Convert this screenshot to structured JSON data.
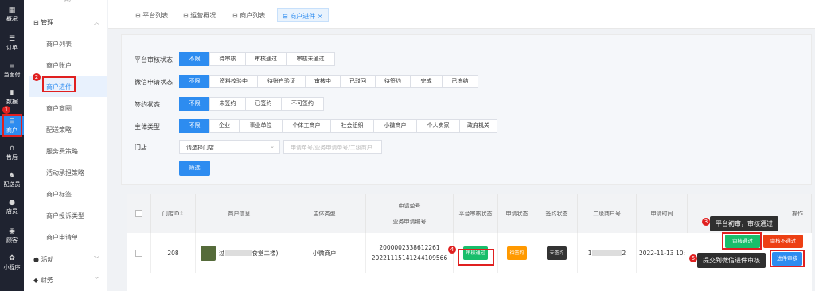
{
  "left_nav": [
    {
      "icon": "chart-icon",
      "label": "概况"
    },
    {
      "icon": "list-icon",
      "label": "订单"
    },
    {
      "icon": "pay-icon",
      "label": "当面付"
    },
    {
      "icon": "data-icon",
      "label": "数据"
    },
    {
      "icon": "store-icon",
      "label": "商户"
    },
    {
      "icon": "headset-icon",
      "label": "售后"
    },
    {
      "icon": "rider-icon",
      "label": "配送员"
    },
    {
      "icon": "user-icon",
      "label": "店员"
    },
    {
      "icon": "customer-icon",
      "label": "顾客"
    },
    {
      "icon": "miniapp-icon",
      "label": "小程序"
    }
  ],
  "submenu": {
    "top_partial": "商户",
    "group": "管理",
    "items": [
      "商户列表",
      "商户账户",
      "商户进件",
      "商户商圈",
      "配送策略",
      "服务费策略",
      "活动承担策略",
      "商户标签",
      "商户投诉类型",
      "商户申请单"
    ],
    "more": [
      "活动",
      "财务"
    ]
  },
  "tabs": [
    "平台列表",
    "运营概况",
    "商户列表",
    "商户进件"
  ],
  "filters": {
    "rows": [
      {
        "label": "平台审核状态",
        "options": [
          "不限",
          "待审核",
          "审核通过",
          "审核未通过"
        ]
      },
      {
        "label": "微信申请状态",
        "options": [
          "不限",
          "资料校验中",
          "待账户验证",
          "审核中",
          "已驳回",
          "待签约",
          "完成",
          "已冻结"
        ]
      },
      {
        "label": "签约状态",
        "options": [
          "不限",
          "未签约",
          "已签约",
          "不可签约"
        ]
      },
      {
        "label": "主体类型",
        "options": [
          "不限",
          "企业",
          "事业单位",
          "个体工商户",
          "社会组织",
          "小微商户",
          "个人卖家",
          "政府机关"
        ]
      }
    ],
    "store_label": "门店",
    "store_select": "请选择门店",
    "apply_placeholder": "申请单号/业务申请单号/二级商户",
    "query_label": "筛选"
  },
  "table": {
    "headers": [
      "门店ID",
      "商户信息",
      "主体类型",
      "申请单号",
      "业务申请编号",
      "平台审核状态",
      "申请状态",
      "签约状态",
      "二级商户号",
      "申请时间",
      "操作"
    ],
    "row": {
      "store_id": "208",
      "merchant": "过",
      "merchant_tail": "食堂二楼)",
      "subject": "小微商户",
      "apply_no": "2000002338612261",
      "biz_no": "2022111514124410956​6",
      "platform_status": "审核通过",
      "apply_status": "待签约",
      "sign_status": "未签约",
      "sub_merchant_head": "1",
      "sub_merchant_tail": "2",
      "apply_time": "2022-11-13 10:",
      "ops": [
        "审核通过",
        "审核不通过",
        "进件审核"
      ]
    }
  },
  "annotations": {
    "badges": [
      "1",
      "2",
      "3",
      "4",
      "5"
    ],
    "tip3": "平台初审，审核通过",
    "tip5": "提交到微信进件审核"
  },
  "colors": {
    "primary": "#2d8cf0",
    "danger": "#e02020",
    "success": "#19be6b",
    "warning": "#ff9900"
  }
}
